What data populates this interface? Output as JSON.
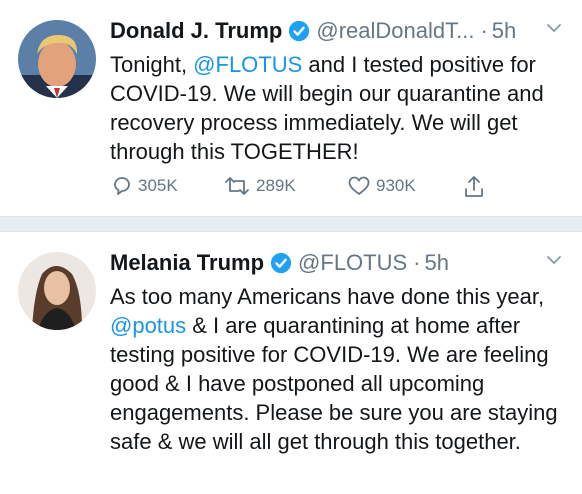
{
  "tweets": [
    {
      "name": "Donald J. Trump",
      "handle": "@realDonaldT...",
      "dot": "·",
      "time": "5h",
      "segments": [
        {
          "t": "Tonight, "
        },
        {
          "t": "@FLOTUS",
          "mention": true
        },
        {
          "t": " and I tested positive for COVID-19. We will begin our quarantine and recovery process immediately. We will get through this TOGETHER!"
        }
      ],
      "replies": "305K",
      "retweets": "289K",
      "likes": "930K"
    },
    {
      "name": "Melania Trump",
      "handle": "@FLOTUS",
      "dot": "·",
      "time": "5h",
      "segments": [
        {
          "t": "As too many Americans have done this year, "
        },
        {
          "t": "@potus",
          "mention": true
        },
        {
          "t": " & I are quarantining at home after testing positive for COVID-19. We are feeling good & I have postponed all upcoming engagements. Please be sure you are staying safe & we will all get through this together."
        }
      ]
    }
  ],
  "colors": {
    "accent": "#1b95e0",
    "muted": "#657786",
    "divider": "#e6ecf0"
  }
}
